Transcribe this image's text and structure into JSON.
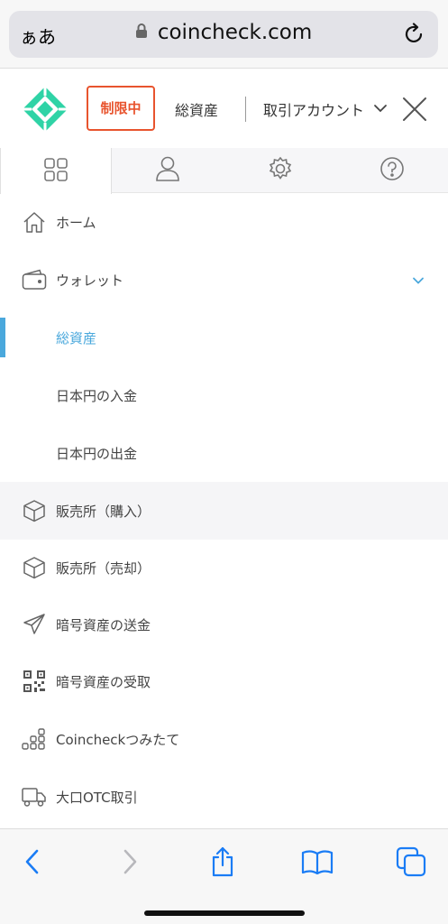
{
  "browser": {
    "text_size_label": "ぁあ",
    "url": "coincheck.com",
    "icons": {
      "lock": "lock-icon",
      "reload": "reload-icon"
    }
  },
  "header": {
    "status_badge": "制限中",
    "total_assets": "総資産",
    "account_selector": "取引アカウント",
    "icons": {
      "logo": "coincheck-logo",
      "chevron": "chevron-down-icon",
      "close": "close-icon"
    }
  },
  "tabs": [
    {
      "name": "grid",
      "icon": "grid-icon",
      "active": true
    },
    {
      "name": "user",
      "icon": "user-icon",
      "active": false
    },
    {
      "name": "settings",
      "icon": "gear-icon",
      "active": false
    },
    {
      "name": "help",
      "icon": "help-icon",
      "active": false
    }
  ],
  "menu": {
    "home": "ホーム",
    "wallet": "ウォレット",
    "wallet_sub": [
      "総資産",
      "日本円の入金",
      "日本円の出金"
    ],
    "buy": "販売所（購入）",
    "sell": "販売所（売却）",
    "send_crypto": "暗号資産の送金",
    "receive_crypto": "暗号資産の受取",
    "tsumitate": "Coincheckつみたて",
    "otc": "大口OTC取引"
  },
  "colors": {
    "accent": "#4aa8dc",
    "badge": "#e8542e",
    "highlight_marker": "#ffd916",
    "logo": "#2fd3a6",
    "ios_blue": "#1a7cf5"
  },
  "toolbar": {
    "icons": [
      "back-icon",
      "forward-icon",
      "share-icon",
      "bookmarks-icon",
      "tabs-icon"
    ]
  }
}
